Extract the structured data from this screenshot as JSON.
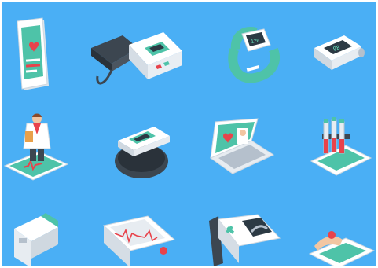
{
  "colors": {
    "background": "#4aaff5",
    "teal": "#4ec3a8",
    "dark_teal": "#2f9c8a",
    "red": "#e8434b",
    "white": "#ffffff",
    "light_gray": "#e7ecf1",
    "gray": "#b5c0cc",
    "dark_gray": "#3c4650",
    "screen_dark": "#2c3a44"
  },
  "icons": [
    "smartphone-health-app-icon",
    "blood-pressure-monitor-icon",
    "fitness-tracker-band-icon",
    "pulse-oximeter-icon",
    "doctor-on-tablet-icon",
    "wrist-blood-pressure-monitor-icon",
    "laptop-telemedicine-icon",
    "blood-test-tubes-analyzer-icon",
    "infrared-thermometer-icon",
    "ecg-monitor-icon",
    "ultrasound-scanner-icon",
    "finger-on-glucose-meter-icon"
  ],
  "screen_readouts": {
    "band": "120",
    "oximeter": "98"
  }
}
